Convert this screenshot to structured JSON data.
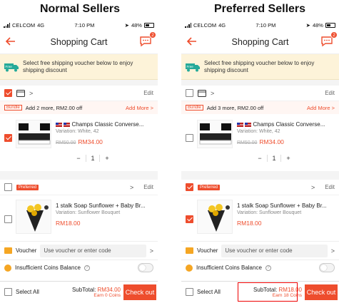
{
  "left_caption": "Normal Sellers",
  "right_caption": "Preferred Sellers",
  "status": {
    "carrier": "CELCOM",
    "network": "4G",
    "time": "7:10 PM",
    "battery": "48%"
  },
  "header": {
    "title": "Shopping Cart",
    "chat_badge": "2"
  },
  "banner": {
    "icon_text": "Free",
    "text_line1": "Select free shipping voucher below to enjoy",
    "text_line2": "shipping discount"
  },
  "shop": {
    "edit": "Edit",
    "chevron": ">"
  },
  "bundle": {
    "tag": "Bundle",
    "more": "Add More >"
  },
  "left": {
    "bundle_text": "Add 2 more, RM2.00 off",
    "subtotal_label": "SubTotal:",
    "subtotal_value": "RM34.00",
    "earn": "Earn 0 Coins"
  },
  "right": {
    "bundle_text": "Add 3 more, RM2.00 off",
    "subtotal_label": "SubTotal:",
    "subtotal_value": "RM18.00",
    "earn": "Earn 18 Coins"
  },
  "item1": {
    "name": "Champs Classic Converse...",
    "variation": "Variation: White, 42",
    "old_price": "RM50.00",
    "price": "RM34.00",
    "minus": "−",
    "qty": "1",
    "plus": "+"
  },
  "preferred_tag": "Preferred",
  "item2": {
    "name": "1 stalk Soap Sunflower + Baby Br...",
    "variation": "Variation: Sunflower Bouquet",
    "price": "RM18.00"
  },
  "voucher": {
    "label": "Voucher",
    "placeholder": "Use voucher or enter code",
    "chevron": ">"
  },
  "coins": {
    "label": "Insufficient Coins Balance",
    "help": "?"
  },
  "footer": {
    "select_all": "Select All",
    "checkout": "Check out"
  },
  "colors": {
    "accent": "#ee4d2d",
    "banner_bg": "#fdf3d9",
    "highlight": "#ee0000"
  }
}
